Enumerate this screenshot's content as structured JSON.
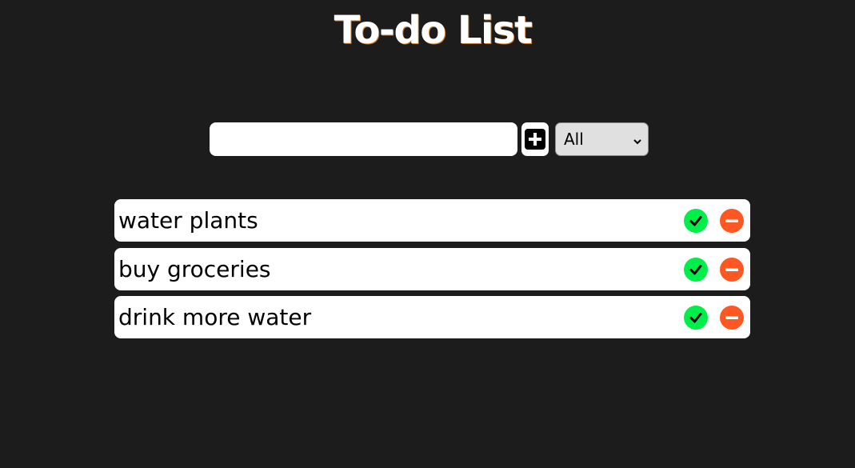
{
  "app": {
    "title": "To-do List"
  },
  "form": {
    "input_value": "",
    "add_icon": "plus-square-icon",
    "filter_selected": "All",
    "filter_options": [
      "All"
    ]
  },
  "todos": [
    {
      "text": "water plants",
      "complete_icon": "check-circle-icon",
      "delete_icon": "minus-circle-icon"
    },
    {
      "text": "buy groceries",
      "complete_icon": "check-circle-icon",
      "delete_icon": "minus-circle-icon"
    },
    {
      "text": "drink more water",
      "complete_icon": "check-circle-icon",
      "delete_icon": "minus-circle-icon"
    }
  ],
  "colors": {
    "background": "#1c1c1c",
    "complete": "#00ee4a",
    "delete": "#ff5722"
  }
}
